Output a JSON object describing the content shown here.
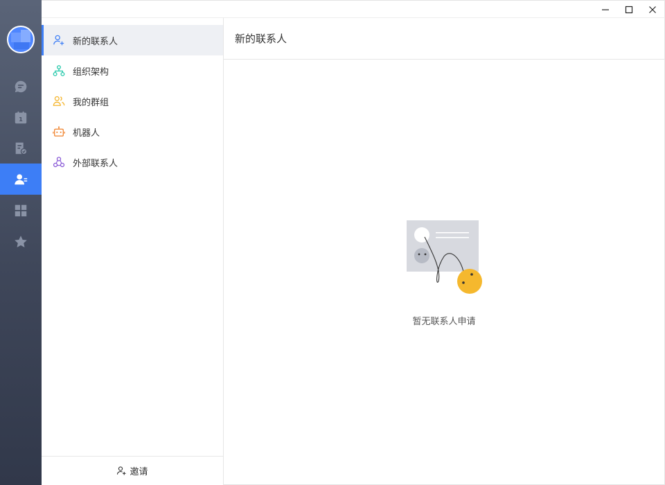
{
  "window": {
    "controls": {
      "minimize": "minimize-icon",
      "maximize": "maximize-icon",
      "close": "close-icon"
    }
  },
  "rail": {
    "accent": "#3d7ef6",
    "items": [
      {
        "icon": "chat-icon",
        "active": false
      },
      {
        "icon": "calendar-icon",
        "badge": "1",
        "active": false
      },
      {
        "icon": "document-icon",
        "active": false
      },
      {
        "icon": "contacts-icon",
        "active": true
      },
      {
        "icon": "apps-grid-icon",
        "active": false
      },
      {
        "icon": "star-icon",
        "active": false
      }
    ]
  },
  "menu": {
    "items": [
      {
        "label": "新的联系人",
        "icon": "add-user-icon",
        "color": "#3d7ef6",
        "active": true
      },
      {
        "label": "组织架构",
        "icon": "org-chart-icon",
        "color": "#1fc7a8",
        "active": false
      },
      {
        "label": "我的群组",
        "icon": "group-icon",
        "color": "#f5b42a",
        "active": false
      },
      {
        "label": "机器人",
        "icon": "robot-icon",
        "color": "#f0822c",
        "active": false
      },
      {
        "label": "外部联系人",
        "icon": "external-contacts-icon",
        "color": "#8756d6",
        "active": false
      }
    ],
    "invite_label": "邀请"
  },
  "main": {
    "title": "新的联系人",
    "empty_text": "暂无联系人申请"
  }
}
